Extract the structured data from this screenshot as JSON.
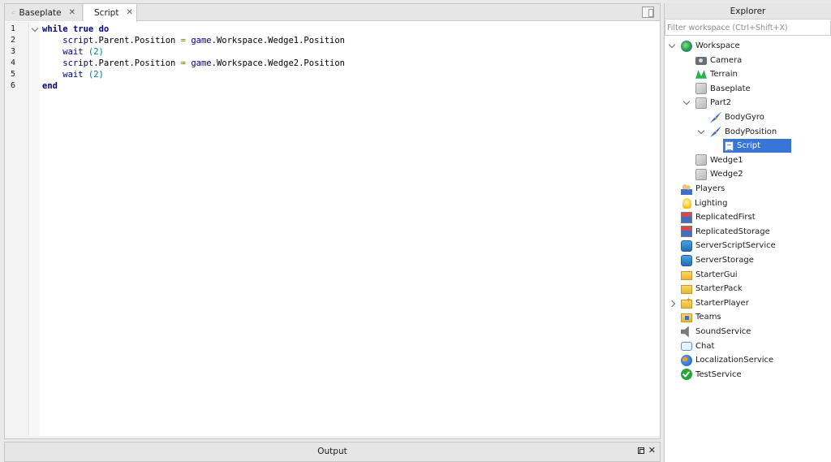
{
  "tabs": [
    {
      "label": "Baseplate",
      "icon": "cloud-icon",
      "active": false
    },
    {
      "label": "Script",
      "active": true
    }
  ],
  "editor": {
    "line_numbers": [
      "1",
      "2",
      "3",
      "4",
      "5",
      "6"
    ],
    "lines": [
      {
        "tokens": [
          {
            "t": "while",
            "c": "kw"
          },
          {
            "t": " "
          },
          {
            "t": "true",
            "c": "kw"
          },
          {
            "t": " "
          },
          {
            "t": "do",
            "c": "kw"
          }
        ]
      },
      {
        "tokens": [
          {
            "t": "    script",
            "c": "id"
          },
          {
            "t": ".Parent.Position "
          },
          {
            "t": "=",
            "c": "op"
          },
          {
            "t": " "
          },
          {
            "t": "game",
            "c": "id"
          },
          {
            "t": ".Workspace.Wedge1.Position"
          }
        ]
      },
      {
        "tokens": [
          {
            "t": "    wait",
            "c": "id"
          },
          {
            "t": " "
          },
          {
            "t": "(2)",
            "c": "num"
          }
        ]
      },
      {
        "tokens": [
          {
            "t": "    script",
            "c": "id"
          },
          {
            "t": ".Parent.Position "
          },
          {
            "t": "=",
            "c": "op"
          },
          {
            "t": " "
          },
          {
            "t": "game",
            "c": "id"
          },
          {
            "t": ".Workspace.Wedge2.Position"
          }
        ]
      },
      {
        "tokens": [
          {
            "t": "    wait",
            "c": "id"
          },
          {
            "t": " "
          },
          {
            "t": "(2)",
            "c": "num"
          }
        ]
      },
      {
        "tokens": [
          {
            "t": "end",
            "c": "kw"
          }
        ]
      }
    ]
  },
  "output": {
    "title": "Output"
  },
  "explorer": {
    "title": "Explorer",
    "filter_placeholder": "Filter workspace (Ctrl+Shift+X)",
    "items": [
      {
        "label": "Workspace",
        "icon": "globe",
        "depth": 0,
        "expand": "down"
      },
      {
        "label": "Camera",
        "icon": "camera",
        "depth": 1
      },
      {
        "label": "Terrain",
        "icon": "terrain",
        "depth": 1
      },
      {
        "label": "Baseplate",
        "icon": "part",
        "depth": 1
      },
      {
        "label": "Part2",
        "icon": "part",
        "depth": 1,
        "expand": "down"
      },
      {
        "label": "BodyGyro",
        "icon": "rocket",
        "depth": 2
      },
      {
        "label": "BodyPosition",
        "icon": "rocket",
        "depth": 2,
        "expand": "down"
      },
      {
        "label": "Script",
        "icon": "scripticon",
        "depth": 3,
        "selected": true
      },
      {
        "label": "Wedge1",
        "icon": "part",
        "depth": 1
      },
      {
        "label": "Wedge2",
        "icon": "part",
        "depth": 1
      },
      {
        "label": "Players",
        "icon": "players",
        "depth": 0
      },
      {
        "label": "Lighting",
        "icon": "bulb",
        "depth": 0
      },
      {
        "label": "ReplicatedFirst",
        "icon": "replicated",
        "depth": 0
      },
      {
        "label": "ReplicatedStorage",
        "icon": "replicated",
        "depth": 0
      },
      {
        "label": "ServerScriptService",
        "icon": "server",
        "depth": 0
      },
      {
        "label": "ServerStorage",
        "icon": "server",
        "depth": 0
      },
      {
        "label": "StarterGui",
        "icon": "folder",
        "depth": 0
      },
      {
        "label": "StarterPack",
        "icon": "folder",
        "depth": 0
      },
      {
        "label": "StarterPlayer",
        "icon": "folder-star",
        "depth": 0,
        "expand": "right"
      },
      {
        "label": "Teams",
        "icon": "teams",
        "depth": 0
      },
      {
        "label": "SoundService",
        "icon": "speaker",
        "depth": 0
      },
      {
        "label": "Chat",
        "icon": "chat",
        "depth": 0
      },
      {
        "label": "LocalizationService",
        "icon": "localization",
        "depth": 0
      },
      {
        "label": "TestService",
        "icon": "check",
        "depth": 0
      }
    ]
  }
}
